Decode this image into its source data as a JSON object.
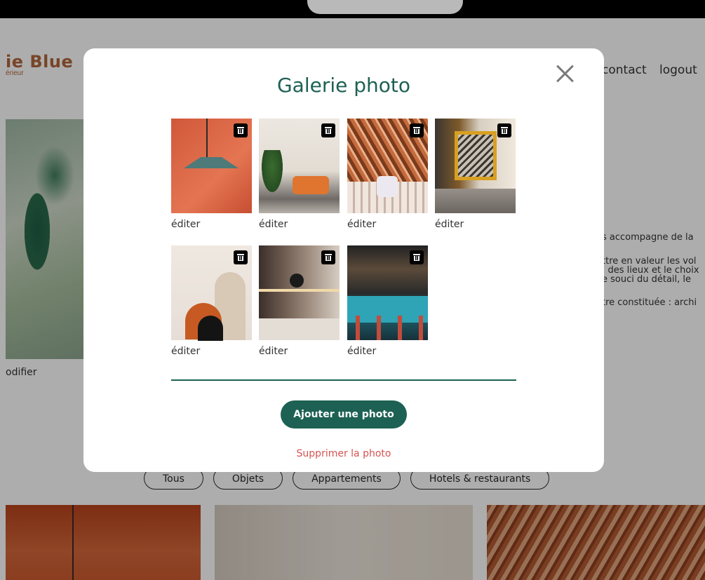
{
  "background_page": {
    "brand_name": "ie Blue",
    "brand_subtitle": "érieur",
    "nav": {
      "contact": "contact",
      "logout": "logout"
    },
    "modify_label": "odifier",
    "about_lines": [
      "s accompagne de la",
      "ttre en valeur les vol",
      ": des lieux et le choix",
      "e souci du détail, le",
      "tre constituée : archi"
    ],
    "filters": [
      "Tous",
      "Objets",
      "Appartements",
      "Hotels & restaurants"
    ]
  },
  "modal": {
    "title": "Galerie photo",
    "close_icon": "close-icon",
    "photos": [
      {
        "edit_label": "éditer",
        "icon": "trash-icon"
      },
      {
        "edit_label": "éditer",
        "icon": "trash-icon"
      },
      {
        "edit_label": "éditer",
        "icon": "trash-icon"
      },
      {
        "edit_label": "éditer",
        "icon": "trash-icon"
      },
      {
        "edit_label": "éditer",
        "icon": "trash-icon"
      },
      {
        "edit_label": "éditer",
        "icon": "trash-icon"
      },
      {
        "edit_label": "éditer",
        "icon": "trash-icon"
      }
    ],
    "add_button": "Ajouter une photo",
    "delete_link": "Supprimer la photo"
  },
  "colors": {
    "accent": "#1d6154",
    "brand": "#b1663c",
    "danger": "#d65353"
  }
}
